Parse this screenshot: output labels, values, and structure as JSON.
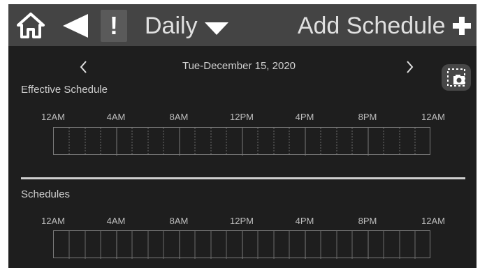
{
  "topbar": {
    "home_icon": "home-icon",
    "back_icon": "back-triangle-icon",
    "alert_text": "!",
    "mode_label": "Daily",
    "mode_caret_icon": "chevron-down-icon",
    "add_label": "Add Schedule",
    "add_icon": "plus-icon"
  },
  "date_nav": {
    "prev_label": "<",
    "date": "Tue-December 15, 2020",
    "next_label": ">"
  },
  "snapshot_icon": "camera-icon",
  "effective": {
    "title": "Effective Schedule",
    "hours": [
      "12AM",
      "4AM",
      "8AM",
      "12PM",
      "4PM",
      "8PM",
      "12AM"
    ]
  },
  "schedules": {
    "title": "Schedules",
    "hours": [
      "12AM",
      "4AM",
      "8AM",
      "12PM",
      "4PM",
      "8PM",
      "12AM"
    ]
  },
  "colors": {
    "topbar_bg": "#444444",
    "screen_bg": "#1e1e1e",
    "text": "#cfcfcf",
    "grid_line": "#7a7a7a"
  }
}
